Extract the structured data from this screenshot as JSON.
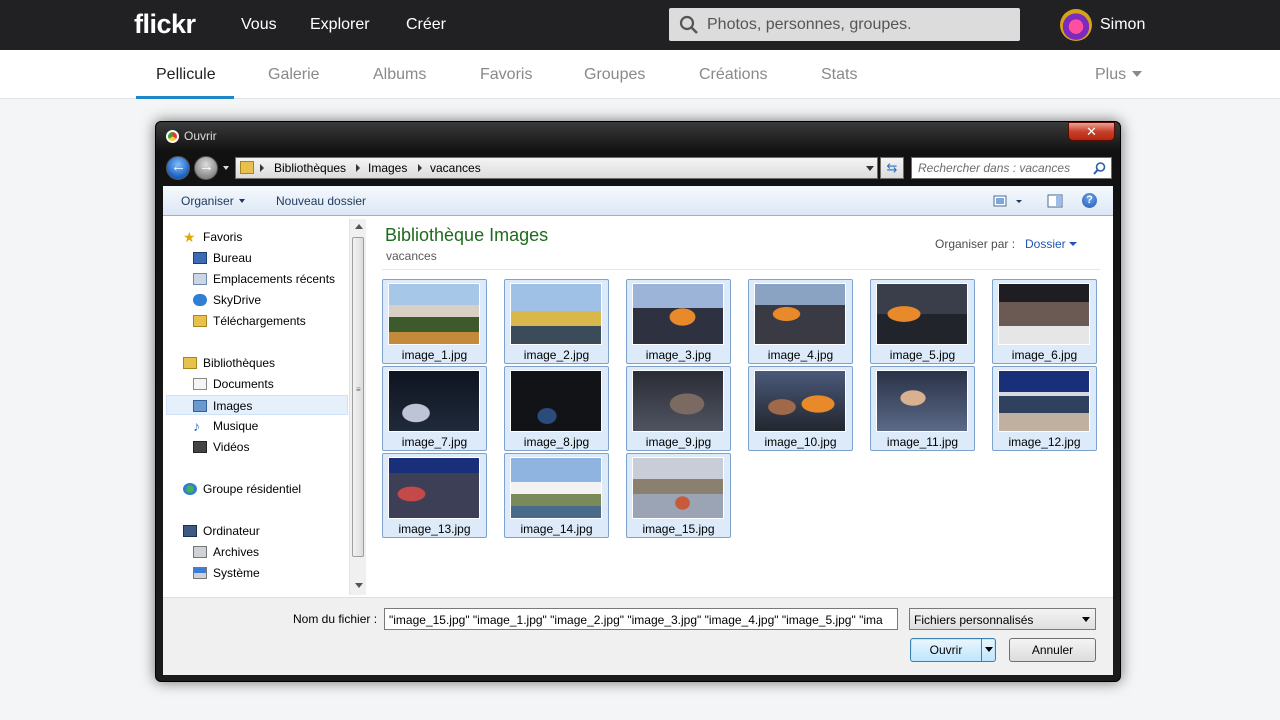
{
  "flickr": {
    "logo": "flickr",
    "nav": [
      "Vous",
      "Explorer",
      "Créer"
    ],
    "search_placeholder": "Photos, personnes, groupes.",
    "username": "Simon"
  },
  "subnav": {
    "tabs": [
      "Pellicule",
      "Galerie",
      "Albums",
      "Favoris",
      "Groupes",
      "Créations",
      "Stats"
    ],
    "active_tab": "Pellicule",
    "more": "Plus"
  },
  "dialog": {
    "title": "Ouvrir",
    "close": "✕",
    "breadcrumb": [
      "Bibliothèques",
      "Images",
      "vacances"
    ],
    "search_placeholder": "Rechercher dans : vacances",
    "toolbar": {
      "organize": "Organiser",
      "new_folder": "Nouveau dossier",
      "help": "?"
    },
    "nav": {
      "favorites_header": "Favoris",
      "favorites": [
        "Bureau",
        "Emplacements récents",
        "SkyDrive",
        "Téléchargements"
      ],
      "libraries_header": "Bibliothèques",
      "libraries": [
        "Documents",
        "Images",
        "Musique",
        "Vidéos"
      ],
      "selected": "Images",
      "homegroup": "Groupe résidentiel",
      "computer_header": "Ordinateur",
      "computer": [
        "Archives",
        "Système"
      ]
    },
    "content": {
      "title": "Bibliothèque Images",
      "subtitle": "vacances",
      "arrange_label": "Organiser par :",
      "arrange_value": "Dossier",
      "files": [
        "image_1.jpg",
        "image_2.jpg",
        "image_3.jpg",
        "image_4.jpg",
        "image_5.jpg",
        "image_6.jpg",
        "image_7.jpg",
        "image_8.jpg",
        "image_9.jpg",
        "image_10.jpg",
        "image_11.jpg",
        "image_12.jpg",
        "image_13.jpg",
        "image_14.jpg",
        "image_15.jpg"
      ]
    },
    "bottom": {
      "filename_label": "Nom du fichier :",
      "filename_value": "\"image_15.jpg\" \"image_1.jpg\" \"image_2.jpg\" \"image_3.jpg\" \"image_4.jpg\" \"image_5.jpg\" \"ima",
      "filter": "Fichiers personnalisés",
      "open": "Ouvrir",
      "cancel": "Annuler"
    }
  },
  "colors": {
    "flickr_bar": "#212124",
    "active_tab_underline": "#1e88c7",
    "library_title": "#1e6a1e",
    "selection": "#dceaf9"
  }
}
